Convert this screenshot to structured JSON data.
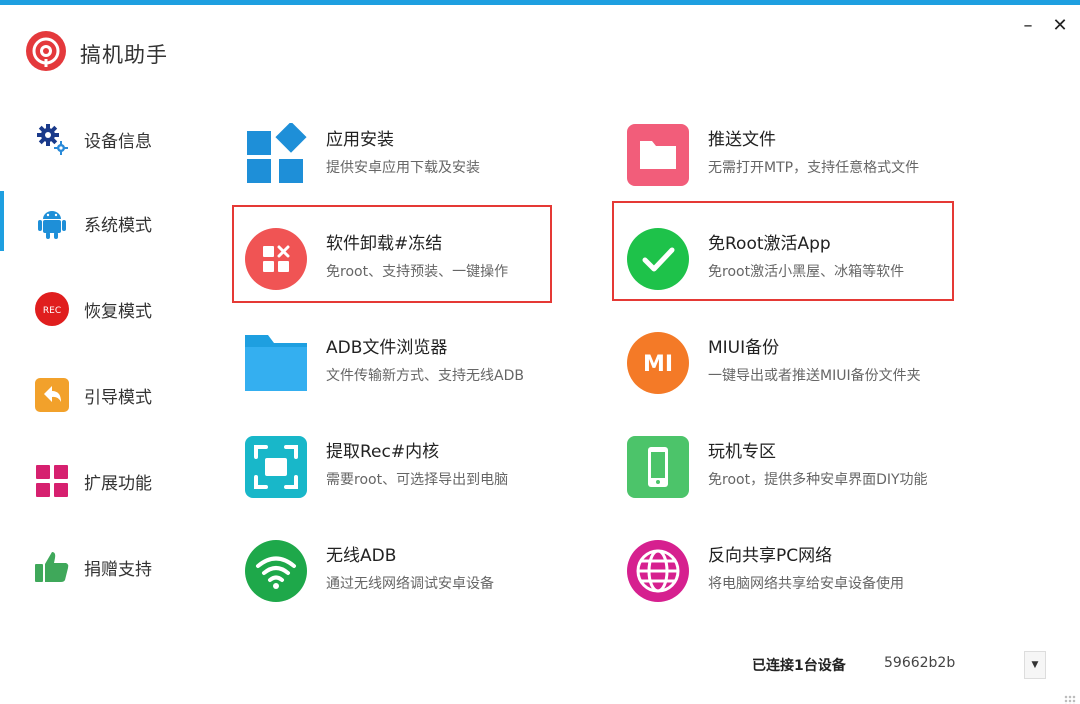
{
  "app": {
    "title": "搞机助手",
    "minimize_label": "–",
    "close_label": "✕"
  },
  "colors": {
    "accent": "#1e9fe0",
    "highlight_border": "#e53935"
  },
  "sidebar": {
    "active_index": 1,
    "items": [
      {
        "label": "设备信息",
        "icon": "gear-icon"
      },
      {
        "label": "系统模式",
        "icon": "android-icon"
      },
      {
        "label": "恢复模式",
        "icon": "rec-icon"
      },
      {
        "label": "引导模式",
        "icon": "back-arrow-icon"
      },
      {
        "label": "扩展功能",
        "icon": "grid-icon"
      },
      {
        "label": "捐赠支持",
        "icon": "thumbs-up-icon"
      }
    ]
  },
  "features": {
    "app_install": {
      "title": "应用安装",
      "desc": "提供安卓应用下载及安装",
      "icon": "windows-tiles-icon",
      "color": "#1e8fd8"
    },
    "push_file": {
      "title": "推送文件",
      "desc": "无需打开MTP，支持任意格式文件",
      "icon": "folder-icon",
      "color": "#f25d7a"
    },
    "uninstall_freeze": {
      "title": "软件卸载#冻结",
      "desc": "免root、支持预装、一键操作",
      "icon": "uninstall-icon",
      "color": "#f05454"
    },
    "root_free_activate": {
      "title": "免Root激活App",
      "desc": "免root激活小黑屋、冰箱等软件",
      "icon": "check-icon",
      "color": "#1ec24a"
    },
    "adb_file_browser": {
      "title": "ADB文件浏览器",
      "desc": "文件传输新方式、支持无线ADB",
      "icon": "folder-blue-icon",
      "color": "#1e9fe0"
    },
    "miui_backup": {
      "title": "MIUI备份",
      "desc": "一键导出或者推送MIUI备份文件夹",
      "icon": "mi-logo-icon",
      "color": "#f47a27",
      "mi_text": "MI"
    },
    "extract_rec": {
      "title": "提取Rec#内核",
      "desc": "需要root、可选择导出到电脑",
      "icon": "scan-frame-icon",
      "color": "#18b7c9"
    },
    "play_zone": {
      "title": "玩机专区",
      "desc": "免root，提供多种安卓界面DIY功能",
      "icon": "phone-icon",
      "color": "#4cc46a"
    },
    "wireless_adb": {
      "title": "无线ADB",
      "desc": "通过无线网络调试安卓设备",
      "icon": "wifi-icon",
      "color": "#1ea84a"
    },
    "reverse_share": {
      "title": "反向共享PC网络",
      "desc": "将电脑网络共享给安卓设备使用",
      "icon": "globe-icon",
      "color": "#d6208f"
    }
  },
  "status": {
    "connected_text": "已连接1台设备",
    "device_id": "59662b2b",
    "dropdown_glyph": "▼"
  }
}
